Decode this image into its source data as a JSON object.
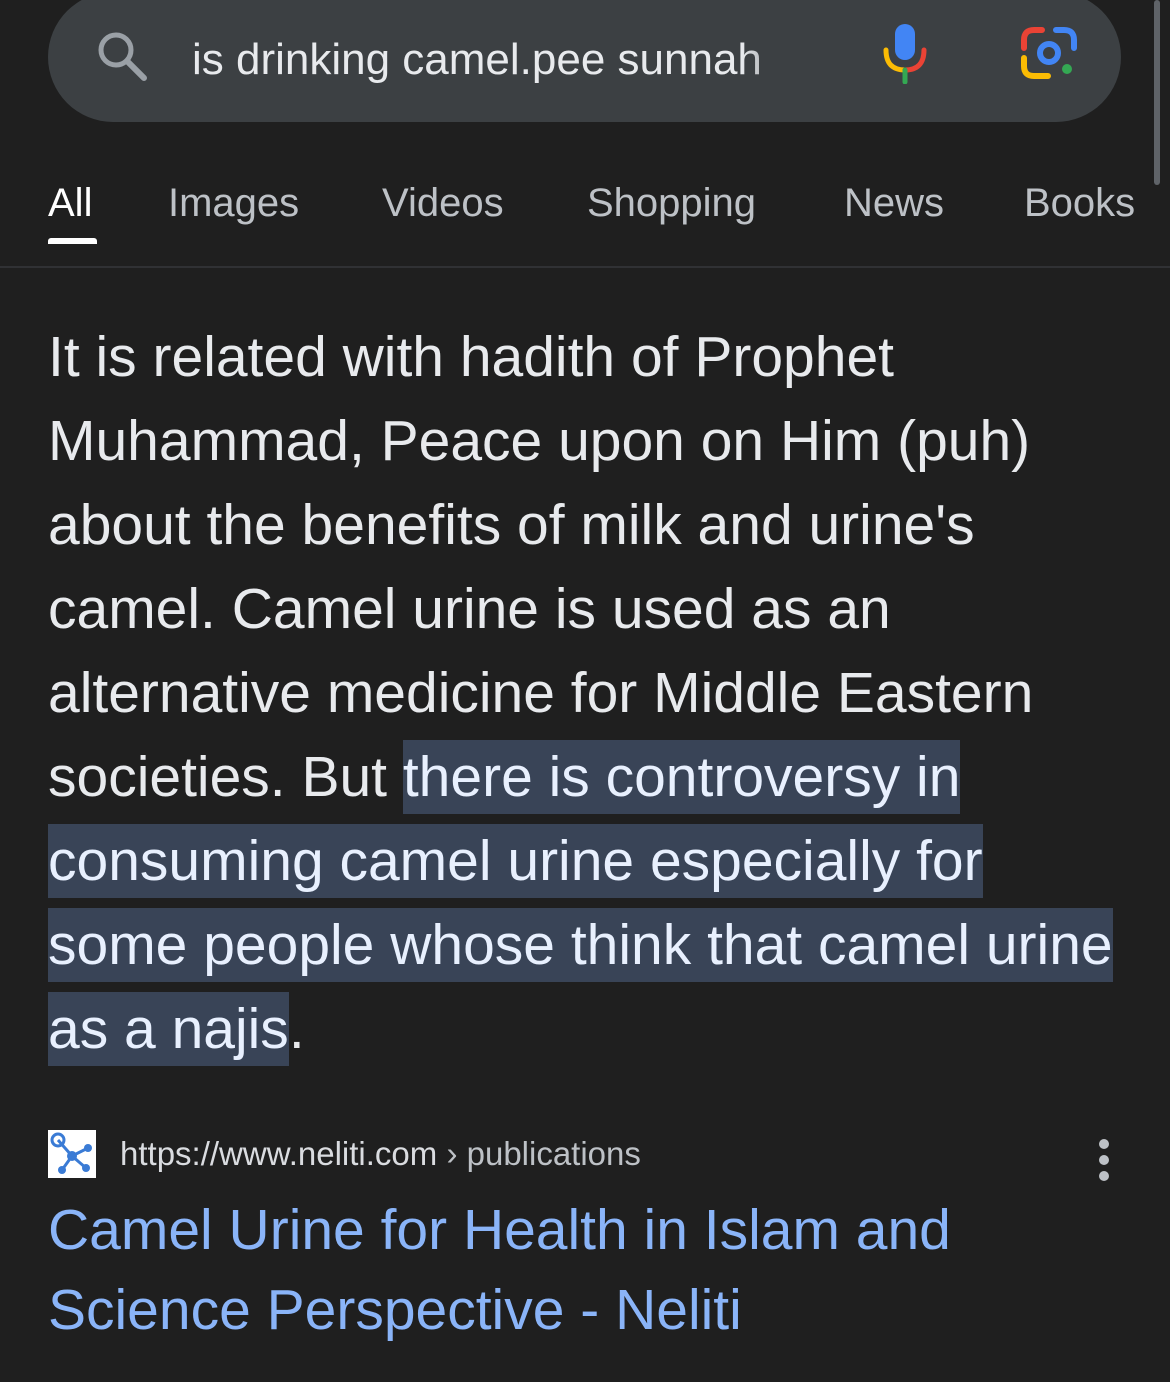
{
  "search": {
    "query": "is drinking camel.pee sunnah"
  },
  "icons": {
    "search": "search-icon",
    "mic": "microphone-icon",
    "lens": "google-lens-icon",
    "more": "more-vert-icon"
  },
  "colors": {
    "background": "#1f1f1f",
    "search_bar": "#3c4043",
    "link": "#8ab4f8",
    "highlight": "#394457"
  },
  "tabs": [
    {
      "label": "All",
      "active": true
    },
    {
      "label": "Images"
    },
    {
      "label": "Videos"
    },
    {
      "label": "Shopping"
    },
    {
      "label": "News"
    },
    {
      "label": "Books"
    }
  ],
  "snippet": {
    "plain": "It is related with hadith of Prophet Muhammad, Peace upon on Him (puh) about the benefits of milk and urine's camel. Camel urine is used as an alternative medicine for Middle Eastern societies. But ",
    "highlighted": "there is controversy in consuming camel urine especially for some people whose think that camel urine as a najis",
    "end": "."
  },
  "result": {
    "url_domain": "https://www.neliti.com",
    "url_path": " › publications",
    "title": "Camel Urine for Health in Islam and Science Perspective - Neliti"
  }
}
